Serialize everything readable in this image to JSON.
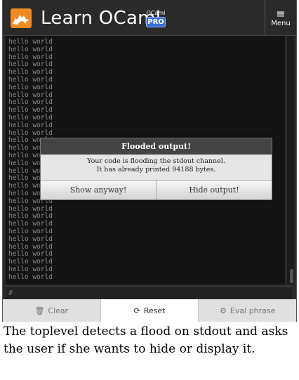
{
  "header": {
    "logo_icon": "camel-icon",
    "title": "Learn OCaml",
    "badge_top": "OCaml",
    "badge_pro": "PRO",
    "menu_label": "Menu"
  },
  "console": {
    "lines": [
      "hello world",
      "hello world",
      "hello world",
      "hello world",
      "hello world",
      "hello world",
      "hello world",
      "hello world",
      "hello world",
      "hello world",
      "hello world",
      "hello world",
      "hello world",
      "hello world",
      "hello world",
      "hello world",
      "hello world",
      "hello world",
      "hello world",
      "hello world",
      "hello world",
      "hello world",
      "hello world",
      "hello world",
      "hello world",
      "hello world",
      "hello world",
      "hello world",
      "hello world",
      "hello world",
      "hello world",
      "hello world"
    ]
  },
  "prompt": {
    "placeholder": "#"
  },
  "modal": {
    "title": "Flooded output!",
    "line1": "Your code is flooding the stdout channel.",
    "line2": "It has already printed 94188 bytes.",
    "show_label": "Show anyway!",
    "hide_label": "Hide output!"
  },
  "buttons": {
    "clear_label": "Clear",
    "reset_label": "Reset",
    "eval_label": "Eval phrase"
  },
  "caption": "The toplevel detects a flood on stdout and asks the user if she wants to hide or display it."
}
